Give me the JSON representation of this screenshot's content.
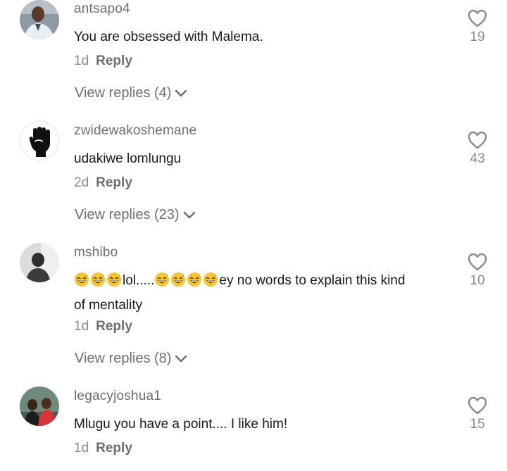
{
  "comments": [
    {
      "username": "antsapo4",
      "text": "You are obsessed with Malema.",
      "time": "1d",
      "reply_label": "Reply",
      "view_replies": "View replies (4)",
      "likes": "19",
      "avatar_icon": "person-photo"
    },
    {
      "username": "zwidewakoshemane",
      "text": "udakiwe lomlungu",
      "time": "2d",
      "reply_label": "Reply",
      "view_replies": "View replies (23)",
      "likes": "43",
      "avatar_icon": "raised-fist-icon"
    },
    {
      "username": "mshibo",
      "text_parts": [
        "lol.....",
        "ey no words to explain this kind",
        "of mentality"
      ],
      "time": "1d",
      "reply_label": "Reply",
      "view_replies": "View replies (8)",
      "likes": "10",
      "avatar_icon": "person-photo"
    },
    {
      "username": "legacyjoshua1",
      "text": "Mlugu you have a point.... I like him!",
      "time": "1d",
      "reply_label": "Reply",
      "likes": "15",
      "avatar_icon": "group-photo"
    }
  ],
  "colors": {
    "text": "#161823",
    "secondary": "#6b6e76",
    "muted": "#8a8b91",
    "emoji_face": "#f7c531"
  }
}
